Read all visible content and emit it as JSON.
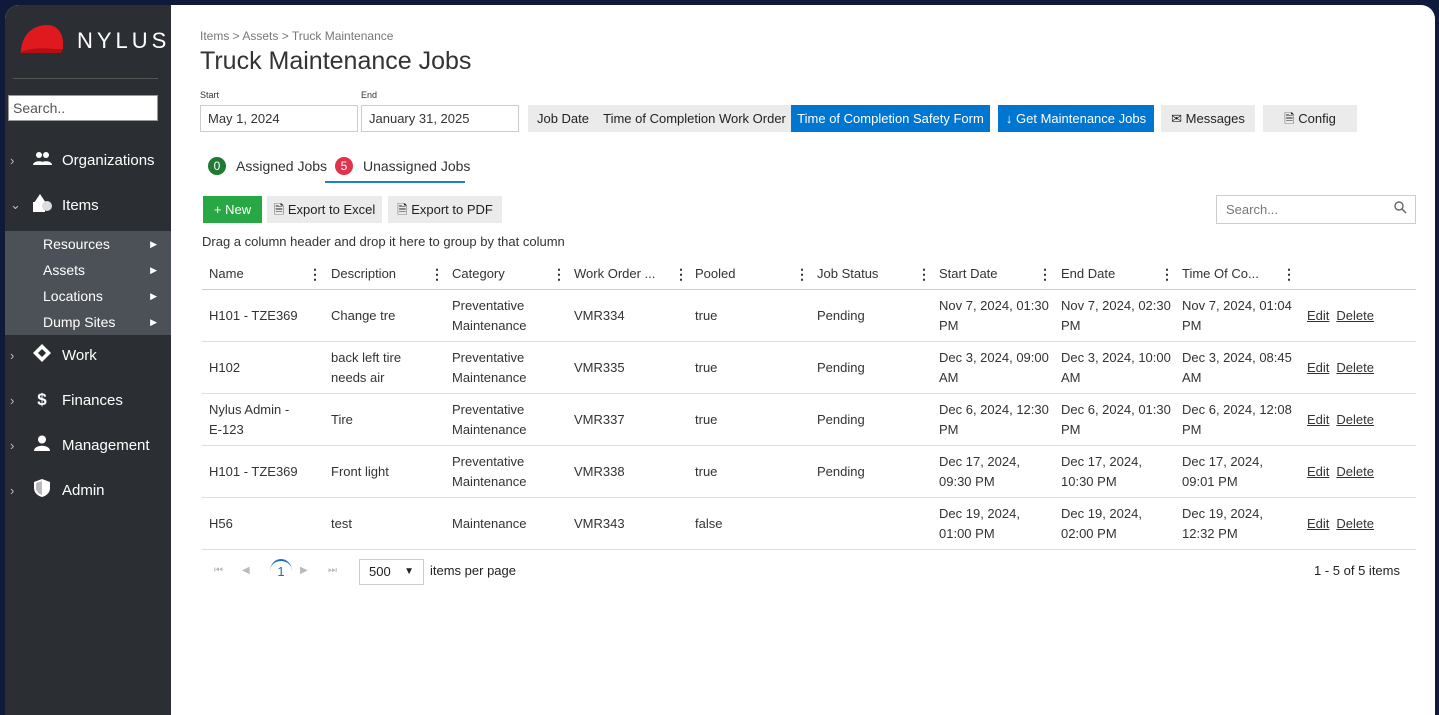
{
  "brand": {
    "name": "NYLUS"
  },
  "sidebar": {
    "search_placeholder": "Search..",
    "items": [
      {
        "label": "Organizations",
        "icon": "users-icon"
      },
      {
        "label": "Items",
        "icon": "shapes-icon"
      },
      {
        "label": "Work",
        "icon": "diamond-icon"
      },
      {
        "label": "Finances",
        "icon": "dollar-icon"
      },
      {
        "label": "Management",
        "icon": "user-icon"
      },
      {
        "label": "Admin",
        "icon": "shield-icon"
      }
    ],
    "subitems": [
      {
        "label": "Resources"
      },
      {
        "label": "Assets"
      },
      {
        "label": "Locations"
      },
      {
        "label": "Dump Sites"
      }
    ]
  },
  "breadcrumb": "Items > Assets > Truck Maintenance",
  "page_title": "Truck Maintenance Jobs",
  "filters": {
    "start_label": "Start",
    "end_label": "End",
    "start_value": "May 1, 2024",
    "end_value": "January 31, 2025",
    "job_date": "Job Date",
    "time_completion_work_order": "Time of Completion Work Order",
    "time_completion_safety_form": "Time of Completion Safety Form",
    "get_jobs": "↓ Get Maintenance Jobs",
    "messages": "Messages",
    "config": "Config"
  },
  "tabs": {
    "assigned": {
      "count": "0",
      "label": "Assigned Jobs"
    },
    "unassigned": {
      "count": "5",
      "label": "Unassigned Jobs"
    }
  },
  "toolbar": {
    "new": "+ New",
    "export_excel": "Export to Excel",
    "export_pdf": "Export to PDF",
    "search_placeholder": "Search..."
  },
  "grid": {
    "group_hint": "Drag a column header and drop it here to group by that column",
    "columns": [
      "Name",
      "Description",
      "Category",
      "Work Order ...",
      "Pooled",
      "Job Status",
      "Start Date",
      "End Date",
      "Time Of Co..."
    ],
    "rows": [
      [
        "H101 - TZE369",
        "Change tre",
        "Preventative Maintenance",
        "VMR334",
        "true",
        "Pending",
        "Nov 7, 2024, 01:30 PM",
        "Nov 7, 2024, 02:30 PM",
        "Nov 7, 2024, 01:04 PM"
      ],
      [
        "H102",
        "back left tire needs air",
        "Preventative Maintenance",
        "VMR335",
        "true",
        "Pending",
        "Dec 3, 2024, 09:00 AM",
        "Dec 3, 2024, 10:00 AM",
        "Dec 3, 2024, 08:45 AM"
      ],
      [
        "Nylus Admin - E-123",
        "Tire",
        "Preventative Maintenance",
        "VMR337",
        "true",
        "Pending",
        "Dec 6, 2024, 12:30 PM",
        "Dec 6, 2024, 01:30 PM",
        "Dec 6, 2024, 12:08 PM"
      ],
      [
        "H101 - TZE369",
        "Front light",
        "Preventative Maintenance",
        "VMR338",
        "true",
        "Pending",
        "Dec 17, 2024, 09:30 PM",
        "Dec 17, 2024, 10:30 PM",
        "Dec 17, 2024, 09:01 PM"
      ],
      [
        "H56",
        "test",
        "Maintenance",
        "VMR343",
        "false",
        "",
        "Dec 19, 2024, 01:00 PM",
        "Dec 19, 2024, 02:00 PM",
        "Dec 19, 2024, 12:32 PM"
      ]
    ],
    "edit_label": "Edit",
    "delete_label": "Delete"
  },
  "pager": {
    "current_page": "1",
    "page_size": "500",
    "per_page_label": "items per page",
    "info": "1 - 5 of 5 items"
  },
  "colors": {
    "sidebar_bg": "#2b2f33",
    "accent_blue": "#0076d1",
    "new_green": "#28a745",
    "badge_green": "#1e7a34",
    "badge_red": "#e0324b",
    "brand_red": "#e0191f"
  }
}
